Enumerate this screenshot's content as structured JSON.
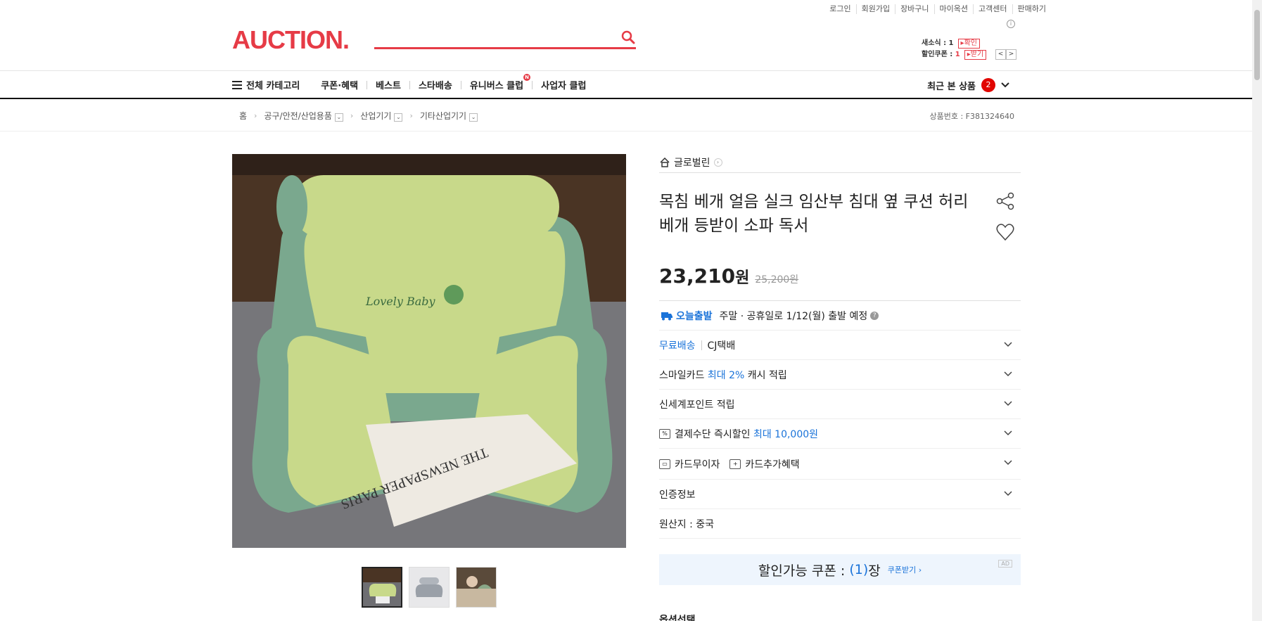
{
  "util_links": [
    "로그인",
    "회원가입",
    "장바구니",
    "마이옥션",
    "고객센터",
    "판매하기"
  ],
  "logo": "AUCTION.",
  "search": {
    "placeholder": ""
  },
  "mini": {
    "news_label": "새소식 : 1",
    "news_btn": "확인",
    "coupon_label": "할인쿠폰 : ",
    "coupon_count": "1",
    "coupon_btn": "받기"
  },
  "nav": {
    "all_category": "전체 카테고리",
    "items": [
      "쿠폰·혜택",
      "베스트",
      "스타배송",
      "유니버스 클럽",
      "사업자 클럽"
    ],
    "new_badge": "N",
    "recent_label": "최근 본 상품",
    "recent_count": "2"
  },
  "breadcrumb": {
    "home": "홈",
    "levels": [
      "공구/안전/산업용품",
      "산업기기",
      "기타산업기기"
    ],
    "item_no": "상품번호 : F381324640"
  },
  "product": {
    "store": "글로벌린",
    "title": "목침 베개 얼음 실크 임산부 침대 옆 쿠션 허리 베개 등받이 소파 독서",
    "price": "23,210",
    "price_unit": "원",
    "original_price": "25,200원",
    "today_ship": "오늘출발",
    "ship_note": "주말 · 공휴일로 1/12(월) 출발 예정",
    "free_ship": "무료배송",
    "courier": "CJ택배",
    "smile_card_pre": "스마일카드",
    "smile_card_max": "최대 2%",
    "smile_card_post": "캐시 적립",
    "shinsegae": "신세계포인트 적립",
    "pay_discount_label": "결제수단 즉시할인",
    "pay_discount_max": "최대 10,000원",
    "card_interest": "카드무이자",
    "card_extra": "카드추가혜택",
    "certification": "인증정보",
    "origin": "원산지 : 중국",
    "coupon_label": "할인가능 쿠폰 :",
    "coupon_count": "(1)",
    "coupon_unit": "장",
    "coupon_get": "쿠폰받기 ›",
    "ad": "AD",
    "option_title": "옵션선택"
  },
  "colors": {
    "brand": "#e63b46",
    "blue": "#1a73d9",
    "pillow_green": "#c8d98a",
    "pillow_side": "#7aa88e"
  },
  "image_texts": {
    "embroidery": "Lovely Baby",
    "newspaper": "THE NEWSPAPER PARIS"
  }
}
